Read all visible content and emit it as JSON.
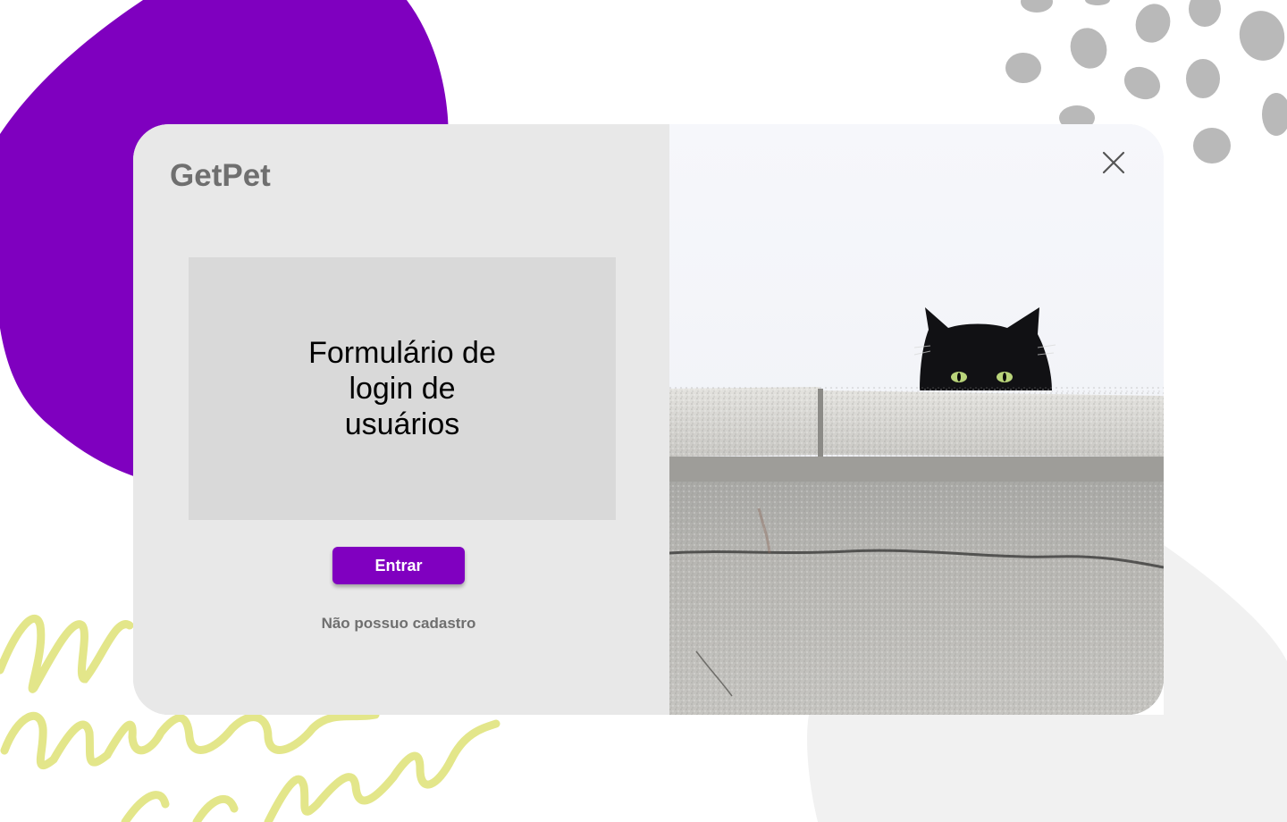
{
  "app": {
    "brand": "GetPet"
  },
  "login": {
    "form_placeholder": "Formulário de login de usuários",
    "submit_label": "Entrar",
    "no_account_link": "Não possuo cadastro"
  },
  "image": {
    "subject": "black-cat-peeking-over-wall"
  },
  "icons": {
    "close": "close-icon"
  },
  "colors": {
    "accent": "#8000c0",
    "blob_purple": "#7f00bf",
    "scribble_yellow": "#e3e68a",
    "panel_gray": "#e8e8e8",
    "placeholder_gray": "#d9d9d9",
    "text_gray": "#6f6f6f"
  }
}
